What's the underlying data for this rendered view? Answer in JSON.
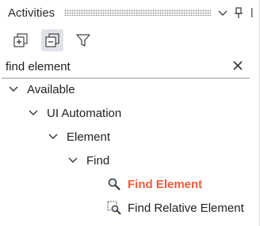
{
  "panel": {
    "title": "Activities"
  },
  "search": {
    "value": "find element"
  },
  "tree": {
    "available": "Available",
    "ui_automation": "UI Automation",
    "element": "Element",
    "find": "Find",
    "find_element": "Find Element",
    "find_relative_element": "Find Relative Element"
  },
  "colors": {
    "highlight": "#f05b3a",
    "active_button_bg": "#dfe3e8",
    "divider": "#c7c7c7"
  },
  "icons": {
    "title_bar": [
      "chevron-down-icon",
      "pin-icon"
    ],
    "toolbar": [
      "expand-all-icon",
      "collapse-all-icon",
      "filter-icon"
    ],
    "search": [
      "clear-icon"
    ],
    "activities": [
      "magnifier-icon",
      "relative-find-icon"
    ]
  }
}
